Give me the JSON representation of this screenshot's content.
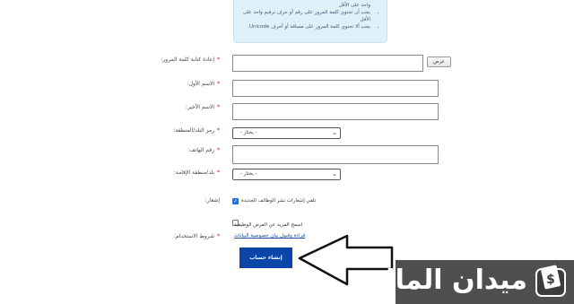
{
  "info_box": {
    "line_top": "واحد على الأقل",
    "rule_digit": "يجب أن تحتوي كلمة المرور على رقم أو حرف ترقيم واحد على",
    "rule_digit_cont": "الأقل",
    "rule_unicode": "يجب ألا تحتوي كلمة المرور على مسافة أو أحرف Unicode."
  },
  "form": {
    "password_confirm": {
      "label": "إعادة كتابة كلمة المرور:",
      "show_button": "عرض"
    },
    "first_name": {
      "label": "الاسم الأول:"
    },
    "last_name": {
      "label": "الاسم الأخير:"
    },
    "country_code": {
      "label": "رمز البلد/المنطقة:",
      "value": "- يختار -"
    },
    "phone": {
      "label": "رقم الهاتف:"
    },
    "residence": {
      "label": "بلد/منطقة الإقامة:",
      "value": "- يختار -"
    },
    "notify": {
      "label": "إشعار:",
      "checkbox_label": "تلقي إشعارات نشر الوظائف الجديدة",
      "checked": true
    },
    "more_jobs": {
      "checkbox_label": "اسمح المزيد عن الفرص الوظيفية",
      "checked": false
    },
    "terms": {
      "label": "شروط الاستخدام:",
      "link": "قراءة وقبول بيان خصوصية البيانات"
    },
    "required_mark": "*",
    "submit_label": "إنشاء حساب"
  },
  "logo": {
    "brand": "ميدان المال",
    "icon_glyph": "$"
  },
  "colors": {
    "accent": "#0b45a8",
    "info_bg": "#dff0f9",
    "logo_bg": "#4f4f4f",
    "required": "#cc0000"
  }
}
